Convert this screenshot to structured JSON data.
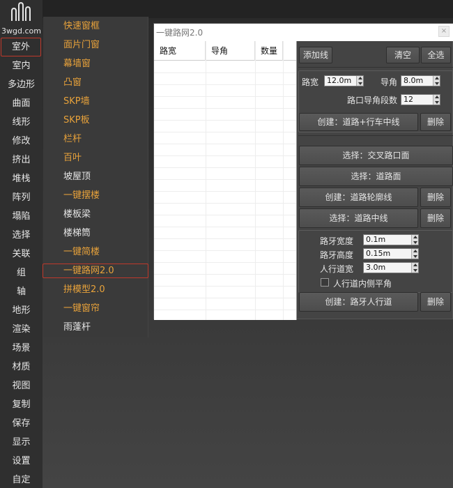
{
  "logo": {
    "text": "3wgd.com",
    "icon": "bars-logo-icon"
  },
  "categories": [
    "室外",
    "室内",
    "多边形",
    "曲面",
    "线形",
    "修改",
    "挤出",
    "堆栈",
    "阵列",
    "塌陷",
    "选择",
    "关联",
    "组",
    "轴",
    "地形",
    "渲染",
    "场景",
    "材质",
    "视图",
    "复制",
    "保存",
    "显示",
    "设置",
    "自定"
  ],
  "submenu": [
    "快速窗框",
    "面片门窗",
    "幕墙窗",
    "凸窗",
    "SKP墙",
    "SKP板",
    "栏杆",
    "百叶",
    "坡屋顶",
    "一键摆楼",
    "楼板梁",
    "楼梯筒",
    "一键简楼",
    "一键路网2.0",
    "拼模型2.0",
    "一键窗帘",
    "雨蓬杆"
  ],
  "dialog": {
    "title": "一键路网2.0",
    "close": "×",
    "columns": [
      "路宽",
      "导角",
      "数量"
    ],
    "add_line": "添加线",
    "clear": "清空",
    "select_all": "全选",
    "road_width_label": "路宽",
    "road_width_value": "12.0m",
    "chamfer_label": "导角",
    "chamfer_value": "8.0m",
    "segments_label": "路口导角段数",
    "segments_value": "12",
    "create_road_center": "创建：道路+行车中线",
    "delete": "删除",
    "select_intersection": "选择：交叉路口面",
    "select_road_surface": "选择：道路面",
    "create_road_outline": "创建：道路轮廓线",
    "select_road_center": "选择：道路中线",
    "curb_width_label": "路牙宽度",
    "curb_width_value": "0.1m",
    "curb_height_label": "路牙高度",
    "curb_height_value": "0.15m",
    "sidewalk_width_label": "人行道宽",
    "sidewalk_width_value": "3.0m",
    "sidewalk_flat_label": "人行道内侧平角",
    "create_curb_sidewalk": "创建：路牙人行道"
  }
}
